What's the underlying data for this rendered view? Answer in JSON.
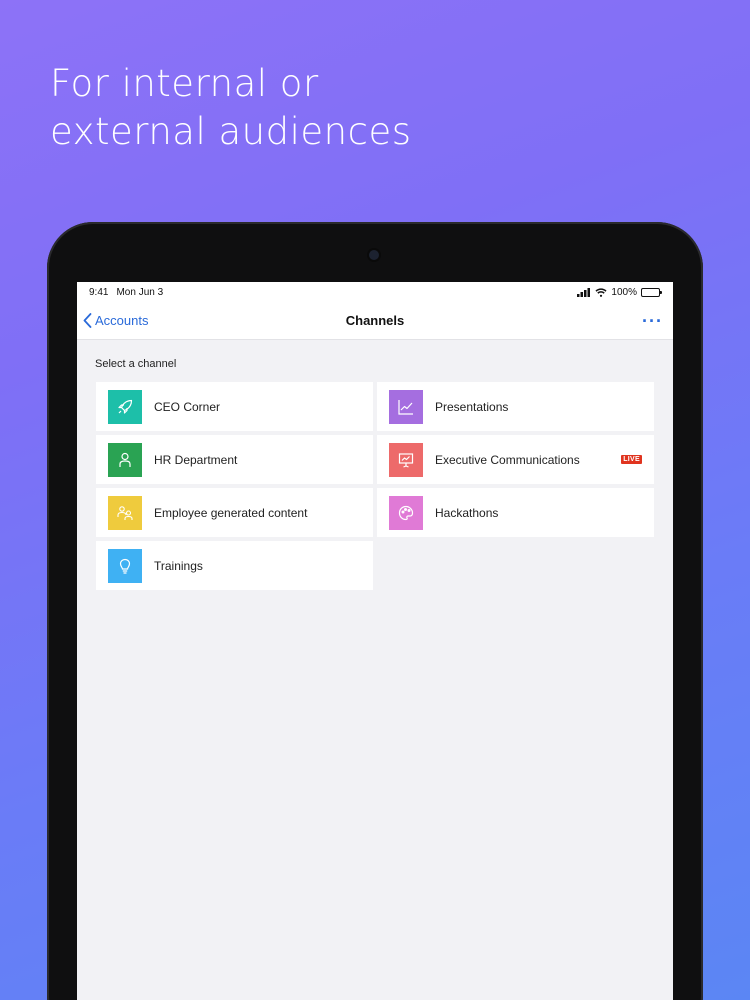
{
  "headline": {
    "line1": "For internal or",
    "line2": "external audiences"
  },
  "statusbar": {
    "time": "9:41",
    "date": "Mon Jun 3",
    "battery": "100%"
  },
  "navbar": {
    "back_label": "Accounts",
    "title": "Channels",
    "more_icon": "ellipsis-icon"
  },
  "section_label": "Select a channel",
  "channels": [
    {
      "label": "CEO Corner",
      "color": "#1dbfa9",
      "icon": "rocket-icon"
    },
    {
      "label": "Presentations",
      "color": "#a56ee0",
      "icon": "line-chart-icon"
    },
    {
      "label": "HR Department",
      "color": "#2aa353",
      "icon": "person-icon"
    },
    {
      "label": "Executive Communications",
      "color": "#ed6a6a",
      "icon": "presentation-board-icon",
      "badge": "LIVE"
    },
    {
      "label": "Employee generated content",
      "color": "#efcb3d",
      "icon": "group-icon"
    },
    {
      "label": "Hackathons",
      "color": "#e07ad6",
      "icon": "palette-icon"
    },
    {
      "label": "Trainings",
      "color": "#3fb1f3",
      "icon": "lightbulb-icon"
    }
  ],
  "colors": {
    "accent": "#2a6ad9",
    "live_badge": "#e0341f"
  }
}
